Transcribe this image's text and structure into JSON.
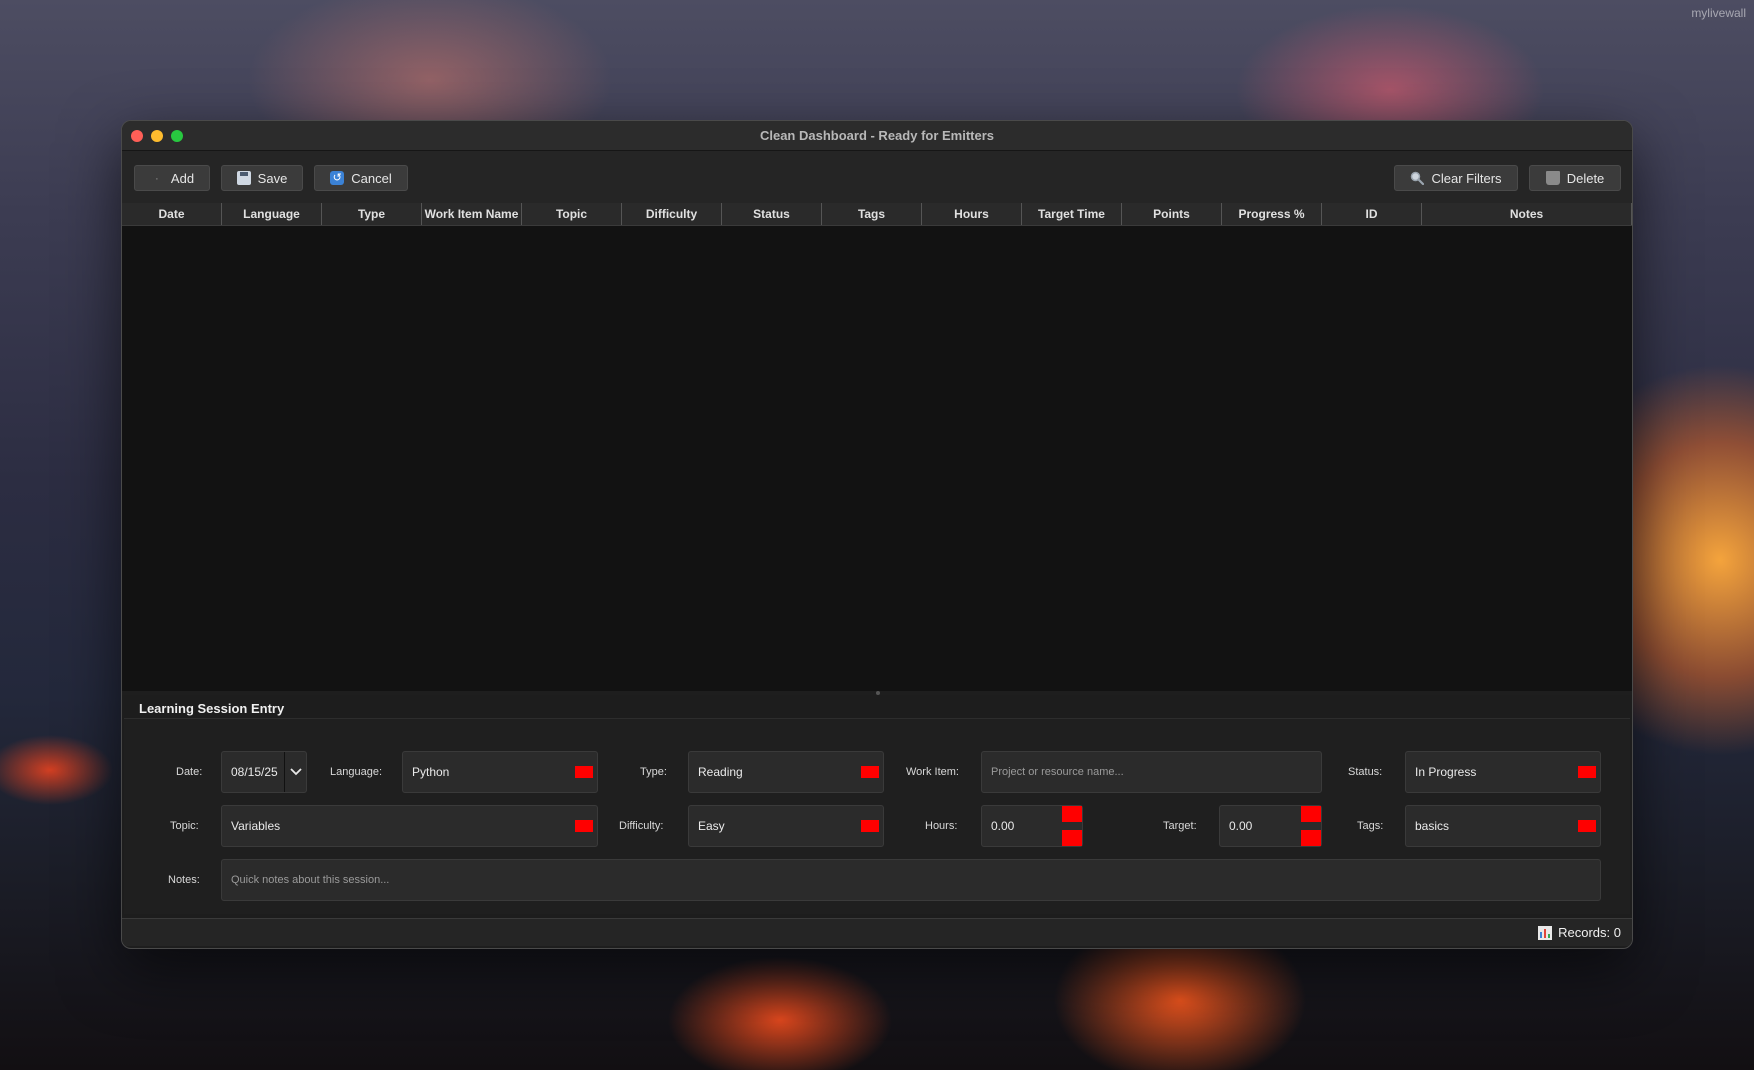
{
  "desktop": {
    "watermark": "mylivewall"
  },
  "window": {
    "title": "Clean Dashboard - Ready for Emitters"
  },
  "toolbar": {
    "add_label": "Add",
    "save_label": "Save",
    "cancel_label": "Cancel",
    "clear_filters_label": "Clear Filters",
    "delete_label": "Delete"
  },
  "table": {
    "columns": [
      "Date",
      "Language",
      "Type",
      "Work Item Name",
      "Topic",
      "Difficulty",
      "Status",
      "Tags",
      "Hours",
      "Target Time",
      "Points",
      "Progress %",
      "ID",
      "Notes"
    ],
    "rows": []
  },
  "form": {
    "title": "Learning Session Entry",
    "date": {
      "label": "Date:",
      "value": "08/15/25"
    },
    "language": {
      "label": "Language:",
      "value": "Python"
    },
    "type": {
      "label": "Type:",
      "value": "Reading"
    },
    "work_item": {
      "label": "Work Item:",
      "placeholder": "Project or resource name..."
    },
    "status": {
      "label": "Status:",
      "value": "In Progress"
    },
    "topic": {
      "label": "Topic:",
      "value": "Variables"
    },
    "difficulty": {
      "label": "Difficulty:",
      "value": "Easy"
    },
    "hours": {
      "label": "Hours:",
      "value": "0.00"
    },
    "target": {
      "label": "Target:",
      "value": "0.00"
    },
    "tags": {
      "label": "Tags:",
      "value": "basics"
    },
    "notes": {
      "label": "Notes:",
      "placeholder": "Quick notes about this session..."
    }
  },
  "statusbar": {
    "records_text": "Records: 0"
  },
  "colors": {
    "arrow_placeholder": "#ff0000",
    "window_bg": "#1e1e1e",
    "table_bg": "#121212"
  }
}
